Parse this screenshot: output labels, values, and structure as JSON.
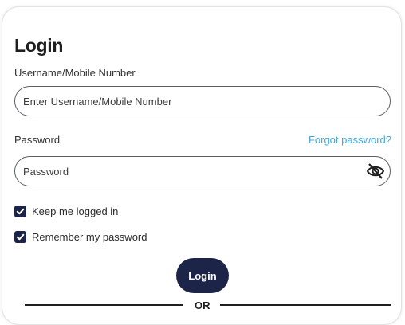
{
  "login": {
    "title": "Login",
    "username_label": "Username/Mobile Number",
    "username_placeholder": "Enter Username/Mobile Number",
    "password_label": "Password",
    "password_placeholder": "Password",
    "forgot_password_link": "Forgot password?",
    "keep_logged_in_label": "Keep me logged in",
    "keep_logged_in_checked": true,
    "remember_password_label": "Remember my password",
    "remember_password_checked": true,
    "login_button_label": "Login",
    "divider_text": "OR"
  },
  "icons": {
    "password_visibility": "eye-slash-icon",
    "checkbox_mark": "checkmark-icon"
  },
  "colors": {
    "primary": "#1c2548",
    "link": "#3fa9de",
    "field_border": "#5a6068",
    "text": "#1f1f1f"
  }
}
